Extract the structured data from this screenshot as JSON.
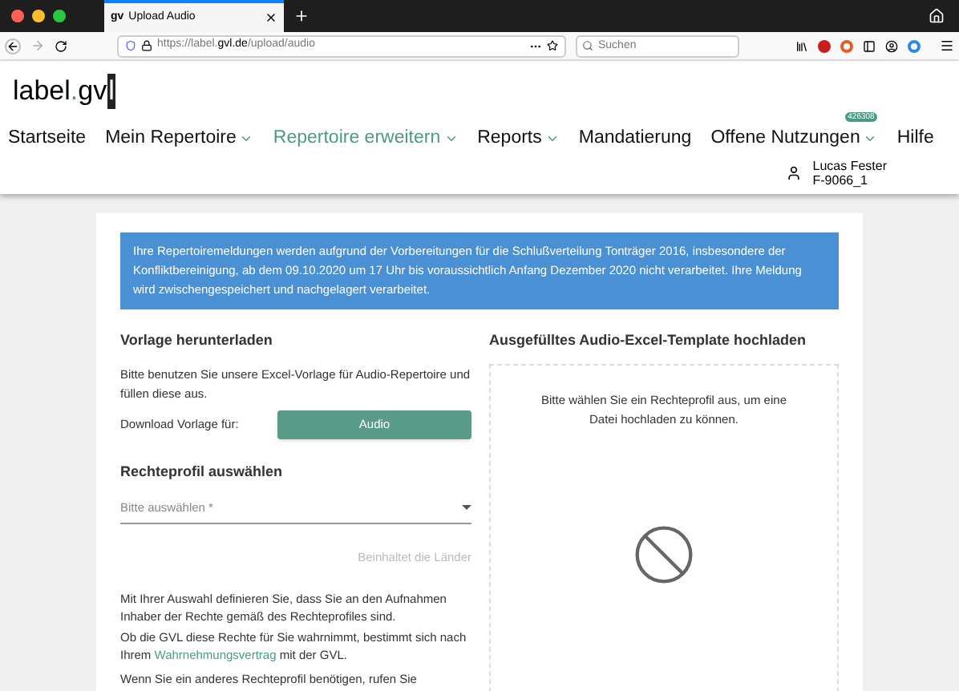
{
  "browser": {
    "tab_title": "Upload Audio",
    "tab_favicon": "gv",
    "url_prefix": "https://label.",
    "url_domain": "gvl.de",
    "url_path": "/upload/audio",
    "search_placeholder": "Suchen"
  },
  "logo": {
    "prefix": "label",
    "dot": ".",
    "middle": "gv",
    "cursor": "l"
  },
  "nav": [
    {
      "label": "Startseite",
      "dropdown": false,
      "selected": false
    },
    {
      "label": "Mein Repertoire",
      "dropdown": true,
      "selected": false
    },
    {
      "label": "Repertoire erweitern",
      "dropdown": true,
      "selected": true
    },
    {
      "label": "Reports",
      "dropdown": true,
      "selected": false
    },
    {
      "label": "Mandatierung",
      "dropdown": false,
      "selected": false
    },
    {
      "label": "Offene Nutzungen",
      "dropdown": true,
      "selected": false,
      "badge": "426308"
    },
    {
      "label": "Hilfe",
      "dropdown": false,
      "selected": false
    }
  ],
  "user": {
    "name": "Lucas Fester",
    "id": "F-9066_1"
  },
  "notice": "Ihre Repertoiremeldungen werden aufgrund der Vorbereitungen für die Schlußverteilung Tonträger 2016, insbesondere der Konfliktbereinigung, ab dem 09.10.2020 um 17 Uhr bis voraussichtlich Anfang Dezember 2020 nicht verarbeitet. Ihre Meldung wird zwischengespeichert und nachgelagert verarbeitet.",
  "download": {
    "heading": "Vorlage herunterladen",
    "text": "Bitte benutzen Sie unsere Excel-Vorlage für Audio-Repertoire und füllen diese aus.",
    "label": "Download Vorlage für:",
    "button": "Audio"
  },
  "profile": {
    "heading": "Rechteprofil auswählen",
    "placeholder": "Bitte auswählen *",
    "countries_button": "Beinhaltet die Länder",
    "text_1": "Mit Ihrer Auswahl definieren Sie, dass Sie an den Aufnahmen Inhaber der Rechte gemäß des Rechteprofiles sind.",
    "text_2_before": "Ob die GVL diese Rechte für Sie wahrnimmt, bestimmt sich nach Ihrem",
    "text_2_link": "Wahrnehmungsvertrag",
    "text_2_after": "mit der GVL.",
    "text_3": "Wenn Sie ein anderes Rechteprofil benötigen, rufen Sie"
  },
  "upload": {
    "heading": "Ausgefülltes Audio-Excel-Template hochladen",
    "message": "Bitte wählen Sie ein Rechteprofil aus, um eine Datei hochladen zu können.",
    "disabled": true
  }
}
